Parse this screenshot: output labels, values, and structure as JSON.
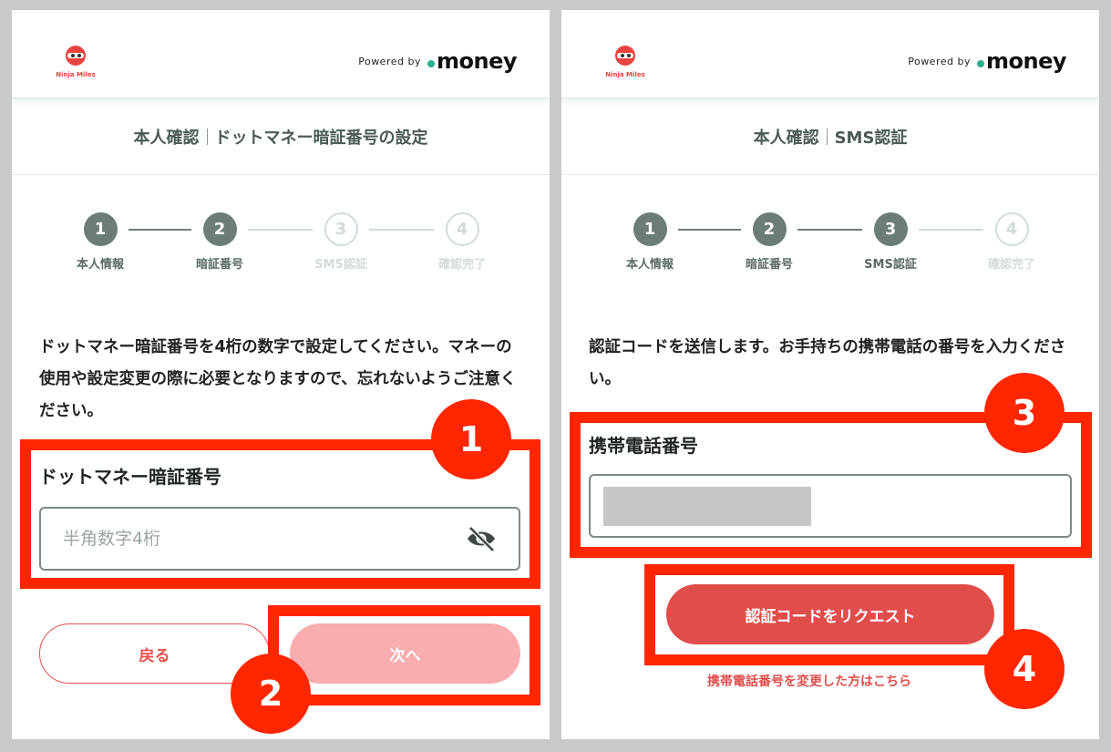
{
  "header": {
    "logo_name": "Ninja Miles",
    "powered_by": "Powered by",
    "brand": "money"
  },
  "steps": [
    "本人情報",
    "暗証番号",
    "SMS認証",
    "確認完了"
  ],
  "left": {
    "title_main": "本人確認",
    "title_sub": "ドットマネー暗証番号の設定",
    "active_steps": 2,
    "description": "ドットマネー暗証番号を4桁の数字で設定してください。マネーの使用や設定変更の際に必要となりますので、忘れないようご注意ください。",
    "field_label": "ドットマネー暗証番号",
    "field_placeholder": "半角数字4桁",
    "back_label": "戻る",
    "next_label": "次へ"
  },
  "right": {
    "title_main": "本人確認",
    "title_sub": "SMS認証",
    "active_steps": 3,
    "description": "認証コードを送信します。お手持ちの携帯電話の番号を入力ください。",
    "field_label": "携帯電話番号",
    "request_label": "認証コードをリクエスト",
    "change_link": "携帯電話番号を変更した方はこちら"
  },
  "annotations": [
    "1",
    "2",
    "3",
    "4"
  ],
  "colors": {
    "accent_red": "#e8514b",
    "step_active": "#6c7d79",
    "step_inactive": "#d2dcda",
    "highlight": "#ff2600",
    "brand_dot": "#2dae8f"
  }
}
